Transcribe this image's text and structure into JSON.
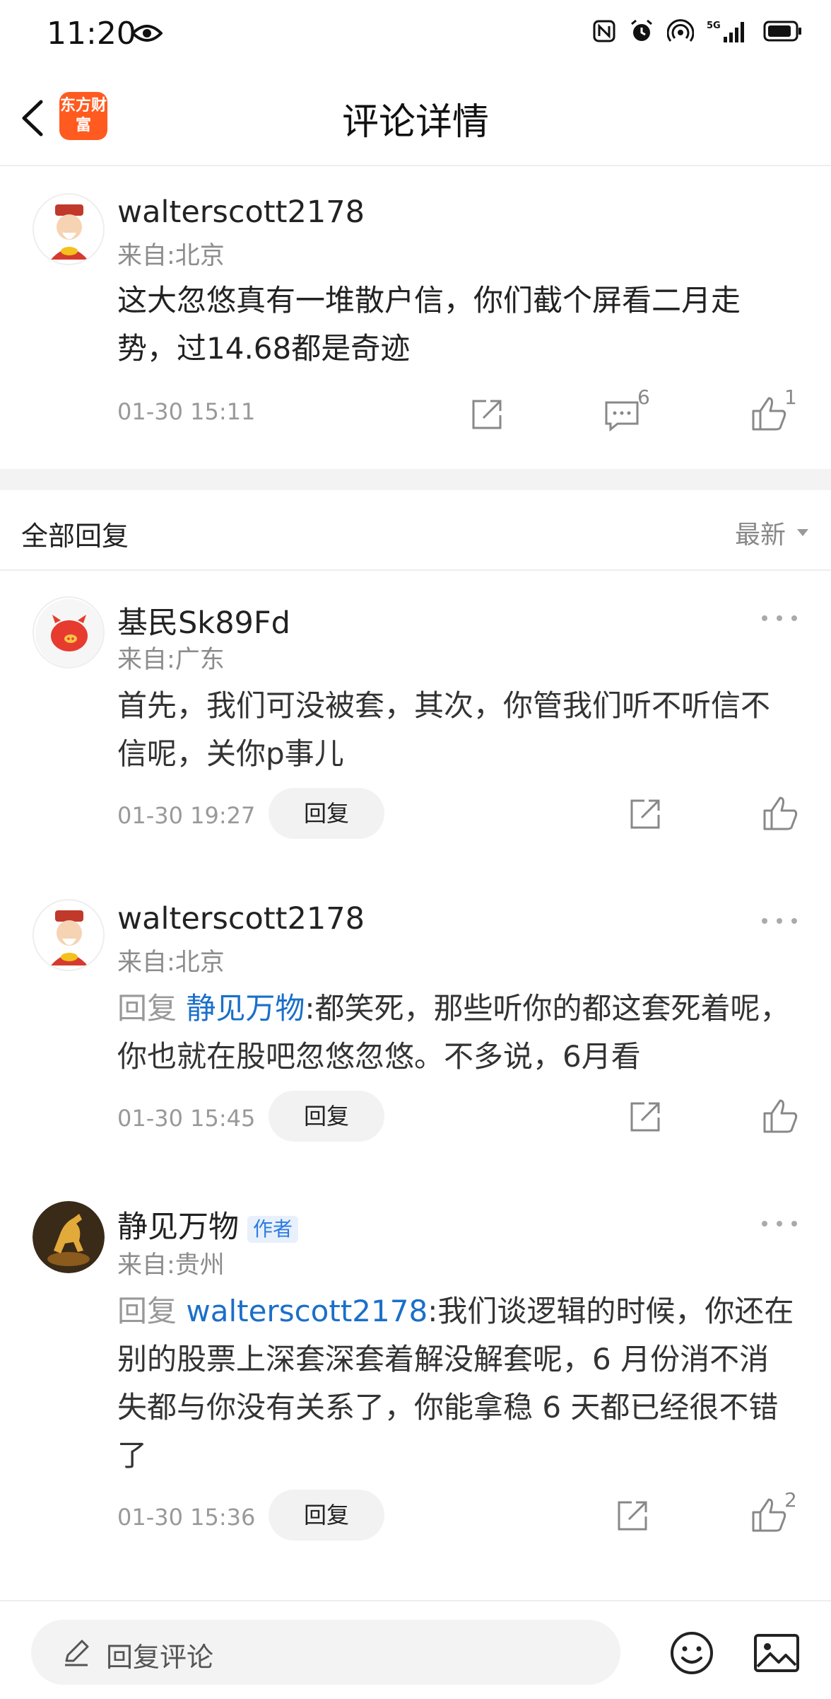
{
  "status_bar": {
    "time": "11:20"
  },
  "header": {
    "title": "评论详情",
    "logo_text": "东方财富"
  },
  "main_comment": {
    "username": "walterscott2178",
    "origin": "来自:北京",
    "body": "这大忽悠真有一堆散户信，你们截个屏看二月走势，过14.68都是奇迹",
    "time": "01-30 15:11",
    "reply_count": "6",
    "like_count": "1"
  },
  "replies_header": {
    "title": "全部回复",
    "sort_label": "最新"
  },
  "replies": [
    {
      "username": "基民Sk89Fd",
      "origin": "来自:广东",
      "body": "首先，我们可没被套，其次，你管我们听不听信不信呢，关你p事儿",
      "time": "01-30 19:27",
      "reply_label": "回复"
    },
    {
      "username": "walterscott2178",
      "origin": "来自:北京",
      "reply_prefix": "回复 ",
      "mention": "静见万物",
      "body": ":都笑死，那些听你的都这套死着呢，你也就在股吧忽悠忽悠。不多说，6月看",
      "time": "01-30 15:45",
      "reply_label": "回复"
    },
    {
      "username": "静见万物",
      "badge": "作者",
      "origin": "来自:贵州",
      "reply_prefix": "回复 ",
      "mention": "walterscott2178",
      "body": ":我们谈逻辑的时候，你还在别的股票上深套深套着解没解套呢，6 月份消不消失都与你没有关系了，你能拿稳 6 天都已经很不错了",
      "time": "01-30 15:36",
      "reply_label": "回复",
      "like_count": "2"
    }
  ],
  "bottom_bar": {
    "placeholder": "回复评论"
  }
}
